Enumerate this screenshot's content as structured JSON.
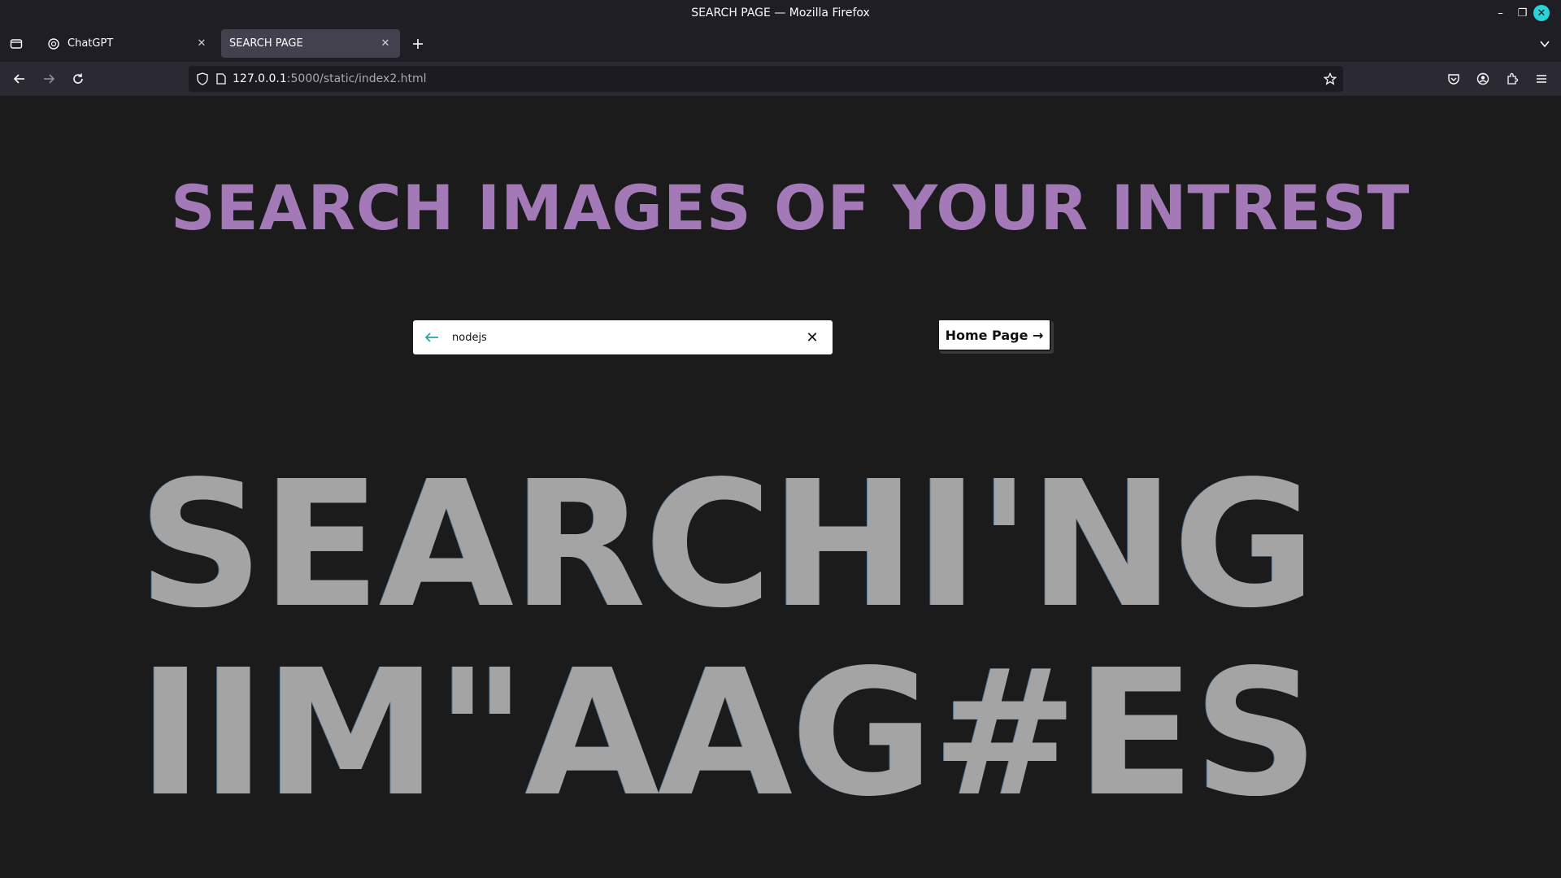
{
  "window": {
    "title": "SEARCH PAGE — Mozilla Firefox"
  },
  "tabs": [
    {
      "label": "ChatGPT",
      "active": false,
      "icon": "chatgpt-icon"
    },
    {
      "label": "SEARCH PAGE",
      "active": true
    }
  ],
  "navbar": {
    "url_host": "127.0.0.1",
    "url_path": ":5000/static/index2.html"
  },
  "page": {
    "title": "SEARCH IMAGES OF YOUR INTREST",
    "search": {
      "value": "nodejs",
      "placeholder": ""
    },
    "home_button_label": "Home Page →",
    "big_text_line1": "SEARCHI'NG",
    "big_text_line2": "IIM\"AAG#ES"
  },
  "colors": {
    "page_background": "#1c1b1b",
    "title_color": "#a37ab7",
    "big_text_color": "#a4a4a4",
    "search_back_arrow": "#2aa8a0",
    "firefox_close": "#28d3da"
  }
}
